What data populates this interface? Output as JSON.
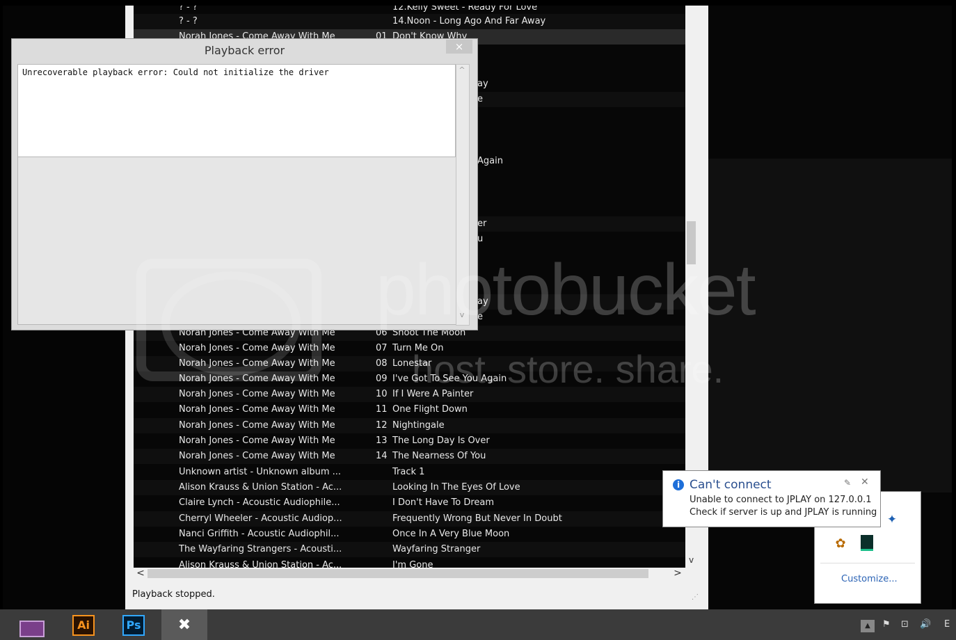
{
  "dialog": {
    "title": "Playback error",
    "close": "×",
    "message": "Unrecoverable playback error: Could not initialize the driver",
    "scroll_up": "^",
    "scroll_down": "v"
  },
  "playlist": {
    "top_rows": [
      {
        "artist": "? - ?",
        "num": "",
        "title": "12.Kelly Sweet - Ready For Love"
      },
      {
        "artist": "? - ?",
        "num": "",
        "title": "14.Noon - Long Ago And Far Away"
      },
      {
        "artist": "Norah Jones - Come Away With Me",
        "num": "01",
        "title": "Don't Know Why"
      }
    ],
    "hidden_fragments": [
      "ay",
      "e",
      "Again",
      "er",
      "u",
      "ay",
      "e"
    ],
    "rows": [
      {
        "artist": "Norah Jones - Come Away With Me",
        "num": "06",
        "title": "Shoot The Moon"
      },
      {
        "artist": "Norah Jones - Come Away With Me",
        "num": "07",
        "title": "Turn Me On"
      },
      {
        "artist": "Norah Jones - Come Away With Me",
        "num": "08",
        "title": "Lonestar"
      },
      {
        "artist": "Norah Jones - Come Away With Me",
        "num": "09",
        "title": "I've Got To See You Again"
      },
      {
        "artist": "Norah Jones - Come Away With Me",
        "num": "10",
        "title": "If I Were A Painter"
      },
      {
        "artist": "Norah Jones - Come Away With Me",
        "num": "11",
        "title": "One Flight Down"
      },
      {
        "artist": "Norah Jones - Come Away With Me",
        "num": "12",
        "title": "Nightingale"
      },
      {
        "artist": "Norah Jones - Come Away With Me",
        "num": "13",
        "title": "The Long Day Is Over"
      },
      {
        "artist": "Norah Jones - Come Away With Me",
        "num": "14",
        "title": "The Nearness Of You"
      },
      {
        "artist": "Unknown artist - Unknown album ...",
        "num": "",
        "title": "Track 1"
      },
      {
        "artist": "Alison Krauss & Union Station - Ac...",
        "num": "",
        "title": "Looking In The Eyes Of Love"
      },
      {
        "artist": "Claire Lynch - Acoustic Audiophile...",
        "num": "",
        "title": "I Don't Have To Dream"
      },
      {
        "artist": "Cherryl Wheeler - Acoustic Audiop...",
        "num": "",
        "title": "Frequently Wrong But Never In Doubt"
      },
      {
        "artist": "Nanci Griffith - Acoustic Audiophil...",
        "num": "",
        "title": "Once In A Very Blue Moon"
      },
      {
        "artist": "The Wayfaring Strangers - Acousti...",
        "num": "",
        "title": "Wayfaring Stranger"
      },
      {
        "artist": "Alison Krauss & Union Station - Ac...",
        "num": "",
        "title": "I'm Gone"
      }
    ],
    "scroll_left": "<",
    "scroll_right": ">",
    "scroll_down": "v"
  },
  "status_bar": {
    "text": "Playback stopped."
  },
  "watermark": {
    "brand": "photobucket",
    "tagline": "host. store. share."
  },
  "notification": {
    "title": "Can't connect",
    "line1": "Unable to connect to JPLAY on 127.0.0.1",
    "line2": "Check if server is up and JPLAY is running",
    "icon": "info-icon",
    "pin": "✎",
    "close": "✕"
  },
  "tray_popup": {
    "customize": "Customize..."
  },
  "taskbar": {
    "apps": [
      "winrar",
      "Ai",
      "Ps",
      "foobar"
    ],
    "ai_label": "Ai",
    "ps_label": "Ps",
    "tray_up": "▲",
    "tray_flag": "⚑",
    "tray_network": "⊡",
    "tray_volume": "🔊",
    "tray_clip": "E"
  },
  "colors": {
    "ai": "#f7931e",
    "ps": "#31a8ff",
    "info": "#1e6fd9",
    "link": "#2b63b5"
  }
}
